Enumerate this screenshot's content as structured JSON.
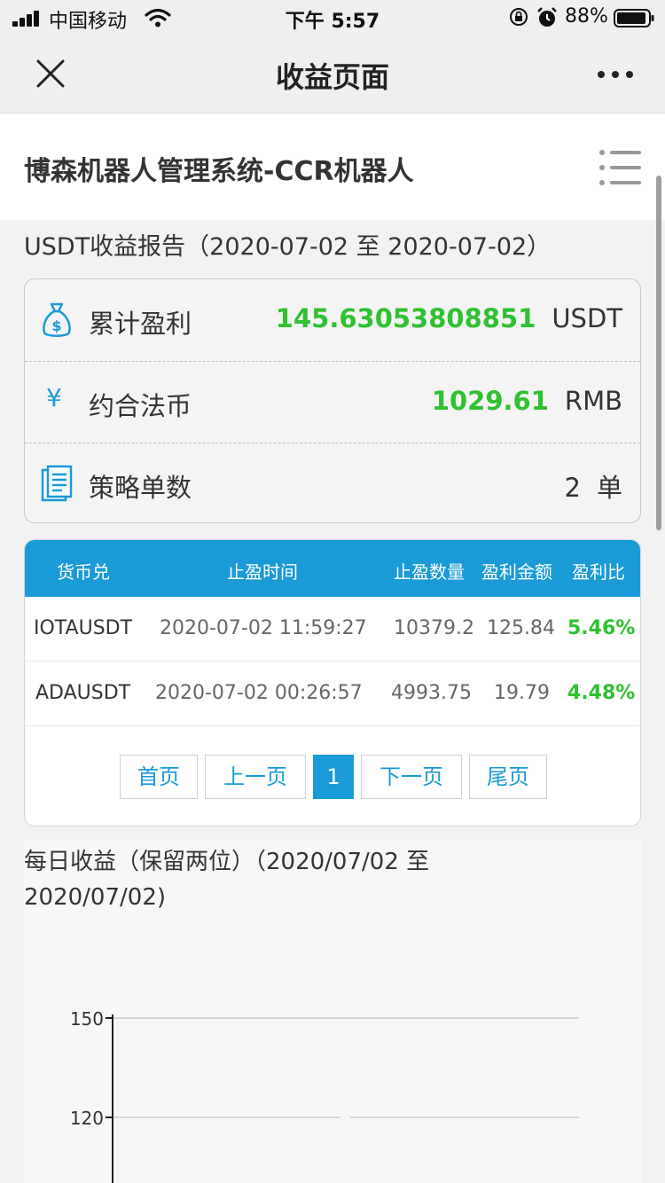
{
  "status_bar": {
    "carrier": "中国移动",
    "time": "下午 5:57",
    "battery": "88%"
  },
  "nav": {
    "title": "收益页面"
  },
  "header": {
    "title": "博森机器人管理系统-CCR机器人"
  },
  "report": {
    "title": "USDT收益报告（2020-07-02 至 2020-07-02）"
  },
  "summary": {
    "profit": {
      "label": "累计盈利",
      "value": "145.63053808851",
      "unit": "USDT"
    },
    "fiat": {
      "icon": "¥",
      "label": "约合法币",
      "value": "1029.61",
      "unit": "RMB"
    },
    "orders": {
      "label": "策略单数",
      "value": "2",
      "unit": "单"
    }
  },
  "table": {
    "headers": [
      "货币兑",
      "止盈时间",
      "止盈数量",
      "盈利金额",
      "盈利比"
    ],
    "rows": [
      {
        "symbol": "IOTAUSDT",
        "time": "2020-07-02 11:59:27",
        "qty": "10379.2",
        "amount": "125.84",
        "ratio": "5.46%"
      },
      {
        "symbol": "ADAUSDT",
        "time": "2020-07-02 00:26:57",
        "qty": "4993.75",
        "amount": "19.79",
        "ratio": "4.48%"
      }
    ]
  },
  "pagination": {
    "first": "首页",
    "prev": "上一页",
    "current": "1",
    "next": "下一页",
    "last": "尾页"
  },
  "chart_data": {
    "type": "bar",
    "title": "每日收益（保留两位）（2020/07/02 至 2020/07/02)",
    "y_ticks": [
      "150",
      "120"
    ],
    "grid": true
  },
  "colors": {
    "accent": "#1a9ad6",
    "positive": "#2fc12f"
  }
}
